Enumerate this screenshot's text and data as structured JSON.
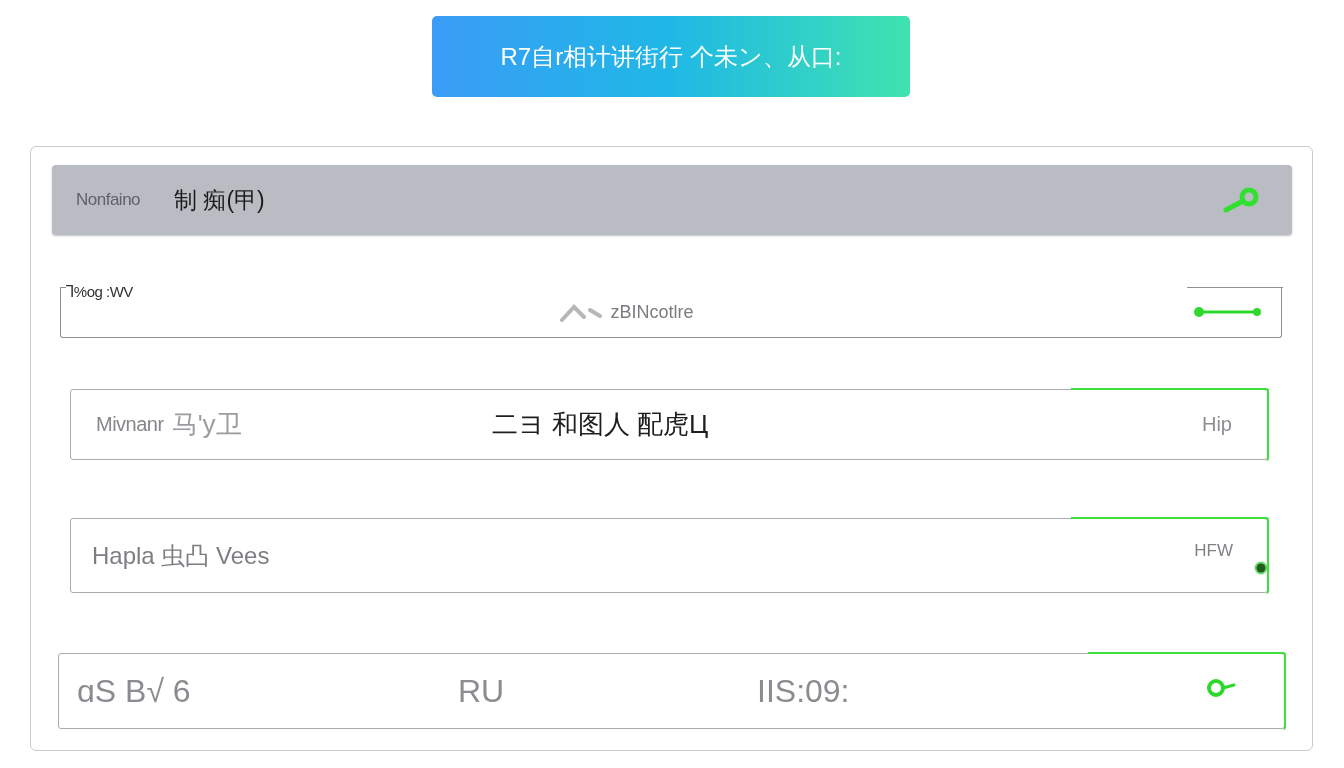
{
  "banner": {
    "title": "R7自r相计讲街行 个未ン、从口:"
  },
  "header": {
    "label": "Nonfaino",
    "title": "制 痴(甲)"
  },
  "rows": [
    {
      "kind": "toggle",
      "label": "Ꞁ%og :WV",
      "center": "zBINcotlre",
      "highlighted": false
    },
    {
      "kind": "text",
      "label": "Mivnanr",
      "value": "马'y卫",
      "center": "二ヨ 和图人 配虎Ц",
      "end": "Hip",
      "highlighted": true
    },
    {
      "kind": "dot",
      "label": "Hapla 虫凸 Vees",
      "end": "HFW",
      "highlighted": true
    },
    {
      "kind": "columns",
      "cells": [
        "ɑS B√ 6",
        "RU",
        "IIS:09:"
      ],
      "highlighted": true
    }
  ]
}
